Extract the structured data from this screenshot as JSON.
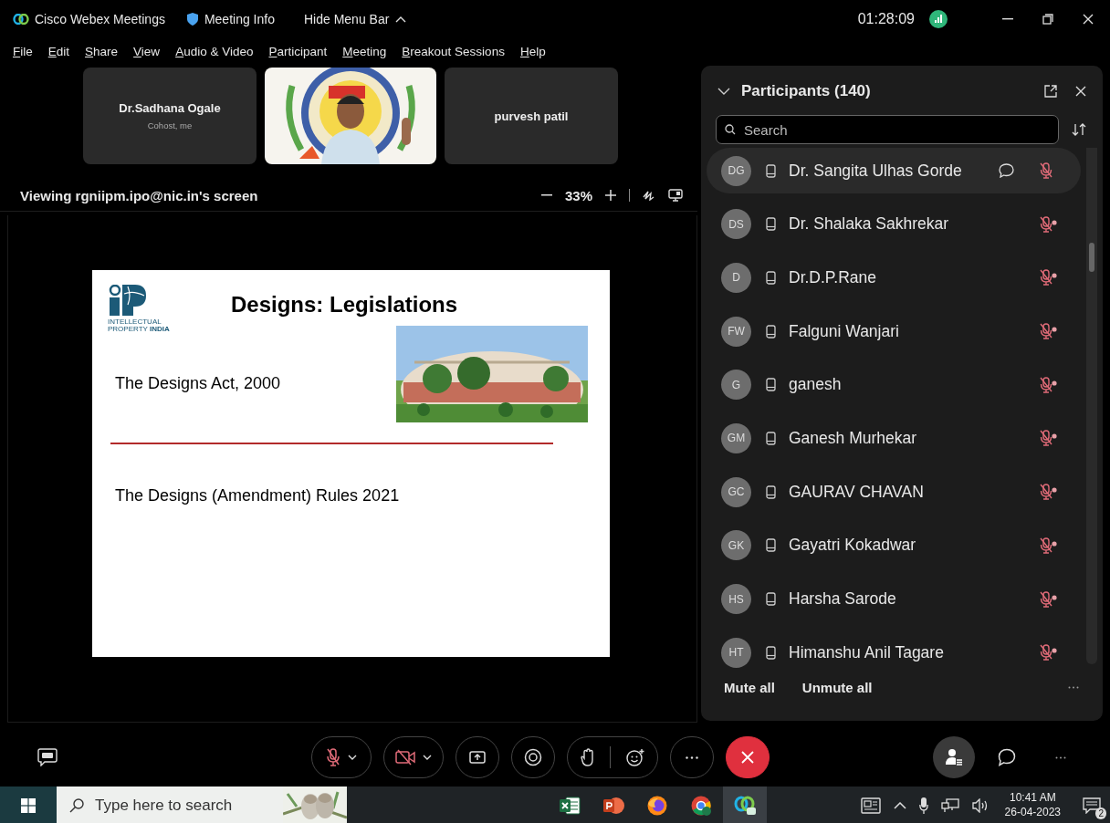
{
  "title_bar": {
    "app": "Cisco Webex Meetings",
    "meeting_info": "Meeting Info",
    "hide_menu": "Hide Menu Bar",
    "timer": "01:28:09"
  },
  "menu": [
    "File",
    "Edit",
    "Share",
    "View",
    "Audio & Video",
    "Participant",
    "Meeting",
    "Breakout Sessions",
    "Help"
  ],
  "video_tiles": [
    {
      "kind": "name",
      "name": "Dr.Sadhana Ogale",
      "role": "Cohost, me"
    },
    {
      "kind": "video"
    },
    {
      "kind": "name",
      "name": "purvesh patil"
    }
  ],
  "share_bar": {
    "viewing": "Viewing rgniipm.ipo@nic.in's screen",
    "zoom": "33%"
  },
  "slide": {
    "title": "Designs: Legislations",
    "logo_lines": [
      "INTELLECTUAL",
      "PROPERTY **INDIA**"
    ],
    "items": [
      "The Designs Act, 2000",
      "The Designs (Amendment) Rules 2021"
    ]
  },
  "participants": {
    "title": "Participants (140)",
    "search_placeholder": "Search",
    "rows": [
      {
        "initials": "DG",
        "name": "Dr. Sangita Ulhas Gorde",
        "highlighted": true,
        "chat": true,
        "mic_badge": false
      },
      {
        "initials": "DS",
        "name": "Dr. Shalaka Sakhrekar",
        "highlighted": false,
        "chat": false,
        "mic_badge": true
      },
      {
        "initials": "D",
        "name": "Dr.D.P.Rane",
        "highlighted": false,
        "chat": false,
        "mic_badge": true
      },
      {
        "initials": "FW",
        "name": "Falguni Wanjari",
        "highlighted": false,
        "chat": false,
        "mic_badge": true
      },
      {
        "initials": "G",
        "name": "ganesh",
        "highlighted": false,
        "chat": false,
        "mic_badge": true
      },
      {
        "initials": "GM",
        "name": "Ganesh Murhekar",
        "highlighted": false,
        "chat": false,
        "mic_badge": true
      },
      {
        "initials": "GC",
        "name": "GAURAV CHAVAN",
        "highlighted": false,
        "chat": false,
        "mic_badge": true
      },
      {
        "initials": "GK",
        "name": "Gayatri Kokadwar",
        "highlighted": false,
        "chat": false,
        "mic_badge": true
      },
      {
        "initials": "HS",
        "name": "Harsha Sarode",
        "highlighted": false,
        "chat": false,
        "mic_badge": true
      },
      {
        "initials": "HT",
        "name": "Himanshu Anil Tagare",
        "highlighted": false,
        "chat": false,
        "mic_badge": true
      }
    ],
    "footer": [
      "Mute all",
      "Unmute all"
    ]
  },
  "controls": {
    "muted": true,
    "video_off": true,
    "participants_open": true
  },
  "taskbar": {
    "search_placeholder": "Type here to search",
    "apps": [
      {
        "kind": "excel",
        "active": false
      },
      {
        "kind": "powerpoint",
        "active": false
      },
      {
        "kind": "firefox",
        "active": false
      },
      {
        "kind": "chrome",
        "active": false
      },
      {
        "kind": "webex",
        "active": true
      }
    ],
    "time": "10:41 AM",
    "date": "26-04-2023",
    "notifications": "2"
  }
}
